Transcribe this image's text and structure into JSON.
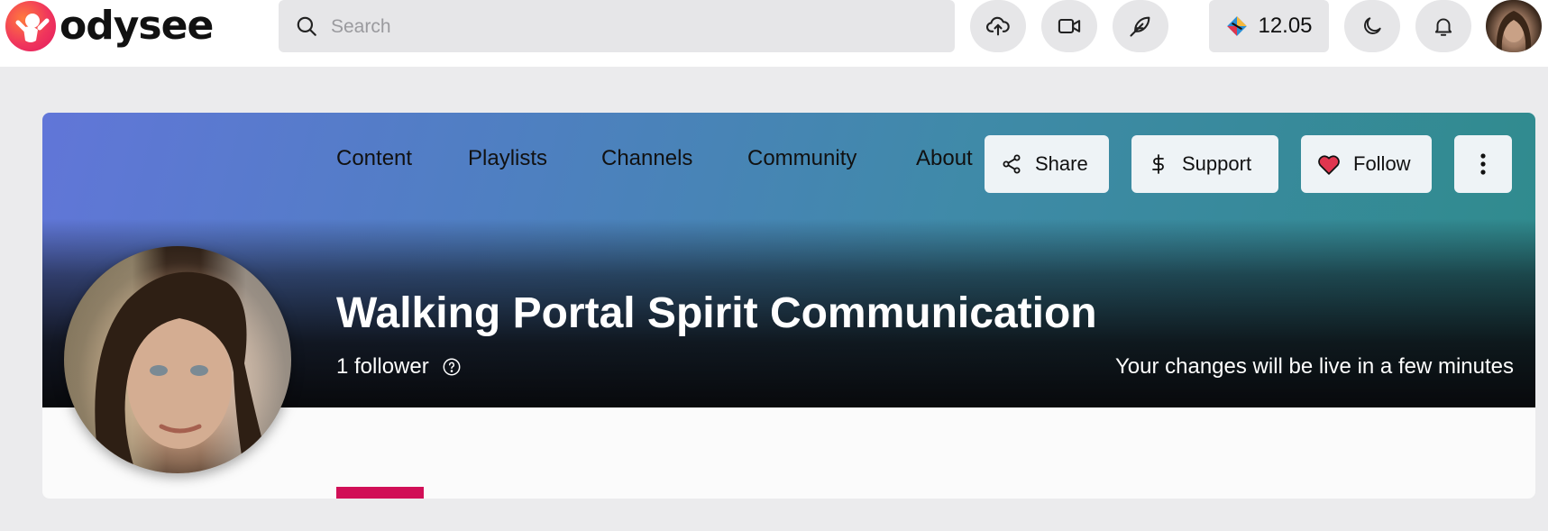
{
  "header": {
    "logo_text": "odysee",
    "search": {
      "placeholder": "Search"
    },
    "wallet_balance": "12.05",
    "icons": [
      "upload-icon",
      "video-icon",
      "feather-icon",
      "moon-icon",
      "bell-icon"
    ]
  },
  "channel": {
    "title": "Walking Portal Spirit Communication",
    "followers": "1 follower",
    "notice": "Your changes will be live in a few minutes",
    "actions": {
      "share": "Share",
      "support": "Support",
      "follow": "Follow"
    },
    "tabs": [
      {
        "label": "Content",
        "selected": true
      },
      {
        "label": "Playlists"
      },
      {
        "label": "Channels"
      },
      {
        "label": "Community"
      },
      {
        "label": "About"
      }
    ]
  },
  "colors": {
    "accent": "#d10f57",
    "heart": "#e0364f",
    "cover_start": "#6176d8",
    "cover_end": "#2f8b8c"
  }
}
